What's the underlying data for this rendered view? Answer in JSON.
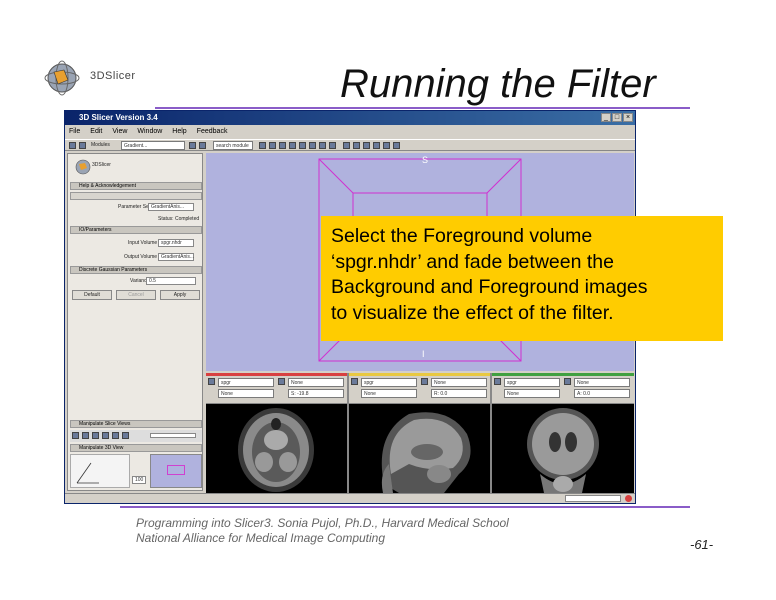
{
  "slide": {
    "title": "Running the Filter",
    "logo_text": "3DSlicer",
    "callout_lines": [
      "Select the Foreground volume",
      "‘spgr.nhdr’ and fade between the",
      "Background and Foreground images",
      "to visualize the effect of the filter."
    ],
    "footer_line1": "Programming into Slicer3. Sonia Pujol, Ph.D., Harvard Medical School",
    "footer_line2": "National Alliance for Medical Image Computing",
    "page_number": "-61-",
    "colors": {
      "accent_line": "#8a5cc8",
      "callout_bg": "#ffcc00"
    }
  },
  "app": {
    "window_title": "3D Slicer Version 3.4",
    "menu": [
      "File",
      "Edit",
      "View",
      "Window",
      "Help",
      "Feedback"
    ],
    "toolbar": {
      "module_label": "Modules",
      "module_value": "Gradient...",
      "search_value": "search module"
    },
    "panel": {
      "logo_text": "3DSlicer",
      "sections": {
        "help": "Help & Acknowledgement",
        "io": "IO/Parameters",
        "gaussian": "Discrete Gaussian Parameters",
        "slice_views": "Manipulate Slice Views",
        "view_3d": "Manipulate 3D View"
      },
      "parameter_set_label": "Parameter Set",
      "parameter_set_value": "GradientAnis...",
      "status": "Status: Completed",
      "input_volume_label": "Input Volume",
      "input_volume_value": "spgr.nhdr",
      "output_volume_label": "Output Volume",
      "output_volume_value": "GradientAnis...",
      "variance_label": "Variance",
      "variance_value": "0.5",
      "buttons": {
        "default": "Default",
        "cancel": "Cancel",
        "apply": "Apply"
      },
      "zoom_value": "100"
    },
    "view3d": {
      "label_top": "S",
      "label_bottom": "I"
    },
    "slices": [
      {
        "name": "Red",
        "bg": "spgr",
        "fg": "None",
        "label": "None",
        "value": "S: -19.8"
      },
      {
        "name": "Yellow",
        "bg": "spgr",
        "fg": "None",
        "label": "None",
        "value": "R: 0.0"
      },
      {
        "name": "Green",
        "bg": "spgr",
        "fg": "None",
        "label": "None",
        "value": "A: 0.0"
      }
    ],
    "slice_colors": [
      "#d84040",
      "#e8c840",
      "#40a040"
    ]
  }
}
